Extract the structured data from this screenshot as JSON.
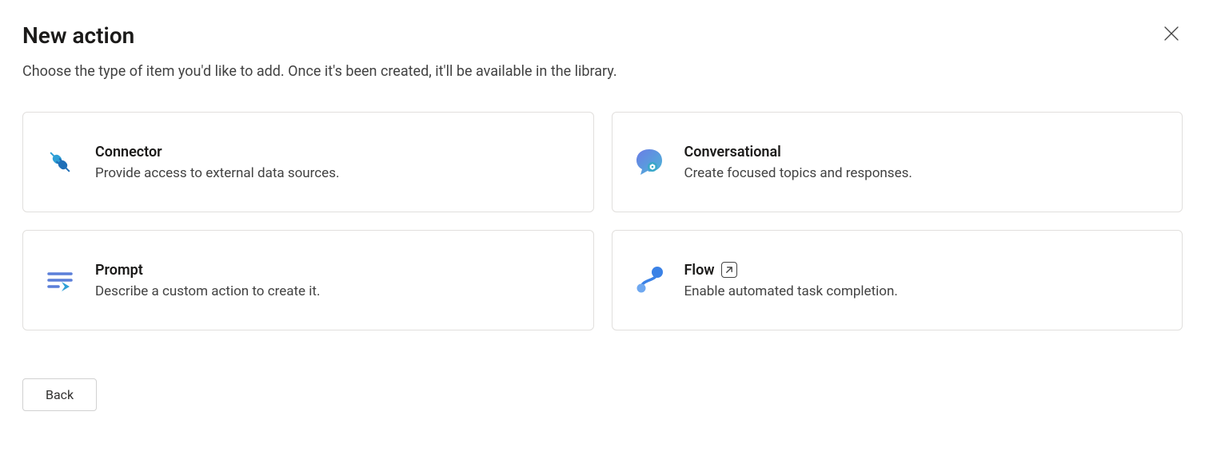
{
  "header": {
    "title": "New action",
    "subtitle": "Choose the type of item you'd like to add. Once it's been created, it'll be available in the library."
  },
  "cards": {
    "connector": {
      "title": "Connector",
      "desc": "Provide access to external data sources."
    },
    "conversational": {
      "title": "Conversational",
      "desc": "Create focused topics and responses."
    },
    "prompt": {
      "title": "Prompt",
      "desc": "Describe a custom action to create it."
    },
    "flow": {
      "title": "Flow",
      "desc": "Enable automated task completion."
    }
  },
  "footer": {
    "back": "Back"
  }
}
